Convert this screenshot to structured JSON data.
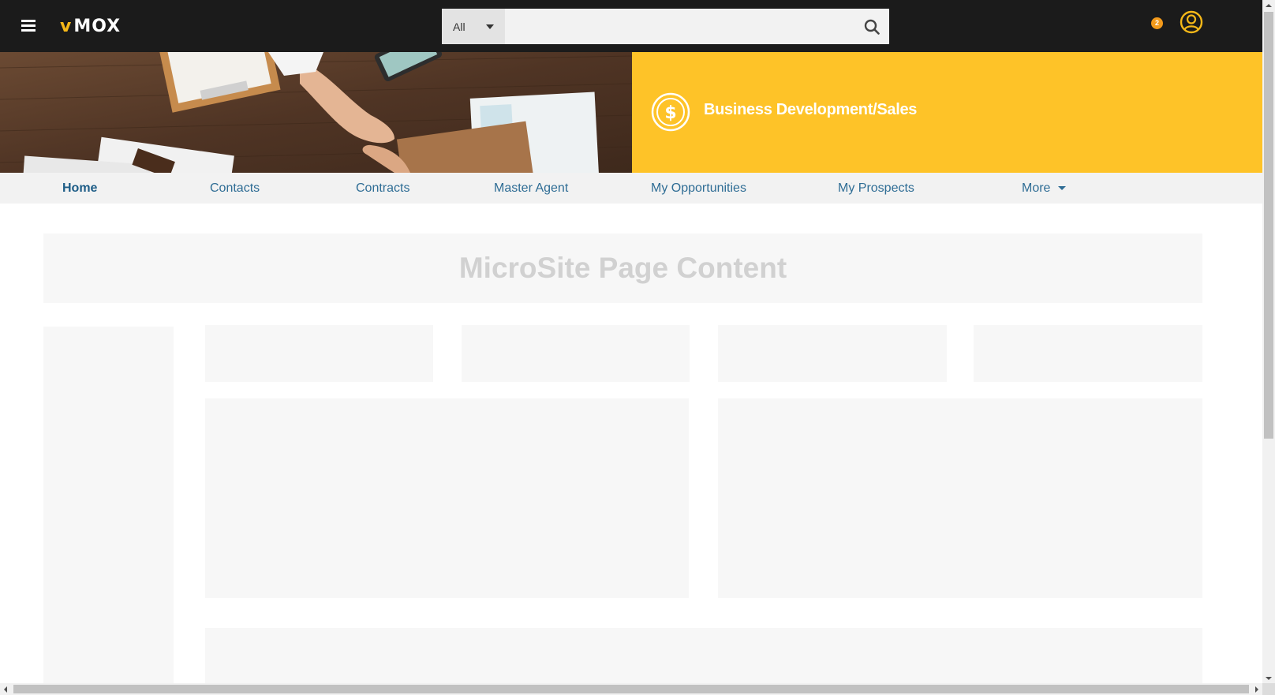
{
  "app": {
    "logo_text": "MOX",
    "logo_mark": "v"
  },
  "search": {
    "scope_label": "All",
    "value": "",
    "placeholder": ""
  },
  "header": {
    "notification_count": "2",
    "icons": [
      "menu-icon",
      "search-icon",
      "user-avatar-icon",
      "chevron-down-icon"
    ]
  },
  "hero": {
    "title": "Business Development/Sales",
    "icon": "dollar-icon",
    "banner_color": "#fec328"
  },
  "nav": {
    "items": [
      {
        "label": "Home",
        "active": true
      },
      {
        "label": "Contacts"
      },
      {
        "label": "Contracts"
      },
      {
        "label": "Master Agent"
      },
      {
        "label": "My Opportunities"
      },
      {
        "label": "My Prospects"
      },
      {
        "label": "More"
      }
    ]
  },
  "content": {
    "title": "MicroSite Page Content"
  },
  "colors": {
    "topbar": "#1b1b1b",
    "accent_orange": "#f39a1b",
    "nav_text": "#2f6d95",
    "placeholder_bg": "#f7f7f7"
  }
}
